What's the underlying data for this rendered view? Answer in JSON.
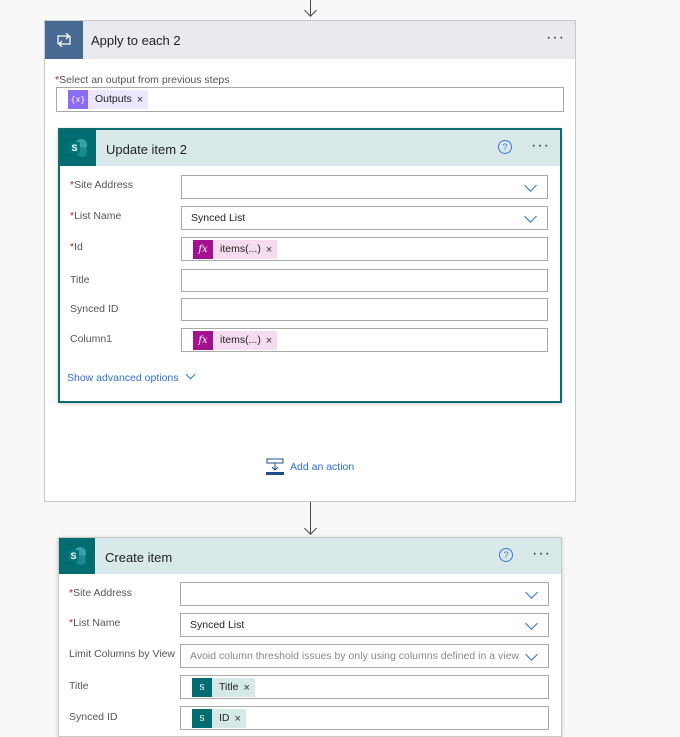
{
  "loop": {
    "title": "Apply to each 2",
    "select_label": "Select an output from previous steps",
    "token": "Outputs"
  },
  "update": {
    "title": "Update item 2",
    "fields": [
      {
        "label": "Site Address",
        "required": true,
        "value": ""
      },
      {
        "label": "List Name",
        "required": true,
        "value": "Synced List"
      },
      {
        "label": "Id",
        "required": true,
        "token": "items(...)"
      },
      {
        "label": "Title",
        "required": false,
        "value": ""
      },
      {
        "label": "Synced ID",
        "required": false,
        "value": ""
      },
      {
        "label": "Column1",
        "required": false,
        "token": "items(...)"
      }
    ],
    "advanced": "Show advanced options"
  },
  "add_action": "Add an action",
  "create": {
    "title": "Create item",
    "fields": [
      {
        "label": "Site Address",
        "required": true,
        "value": ""
      },
      {
        "label": "List Name",
        "required": true,
        "value": "Synced List"
      },
      {
        "label": "Limit Columns by View",
        "placeholder": "Avoid column threshold issues by only using columns defined in a view"
      },
      {
        "label": "Title",
        "token": "Title"
      },
      {
        "label": "Synced ID",
        "token": "ID"
      }
    ]
  },
  "colors": {
    "teal": "#036c70",
    "fx": "#a4118f",
    "var": "#8c6cf0"
  }
}
